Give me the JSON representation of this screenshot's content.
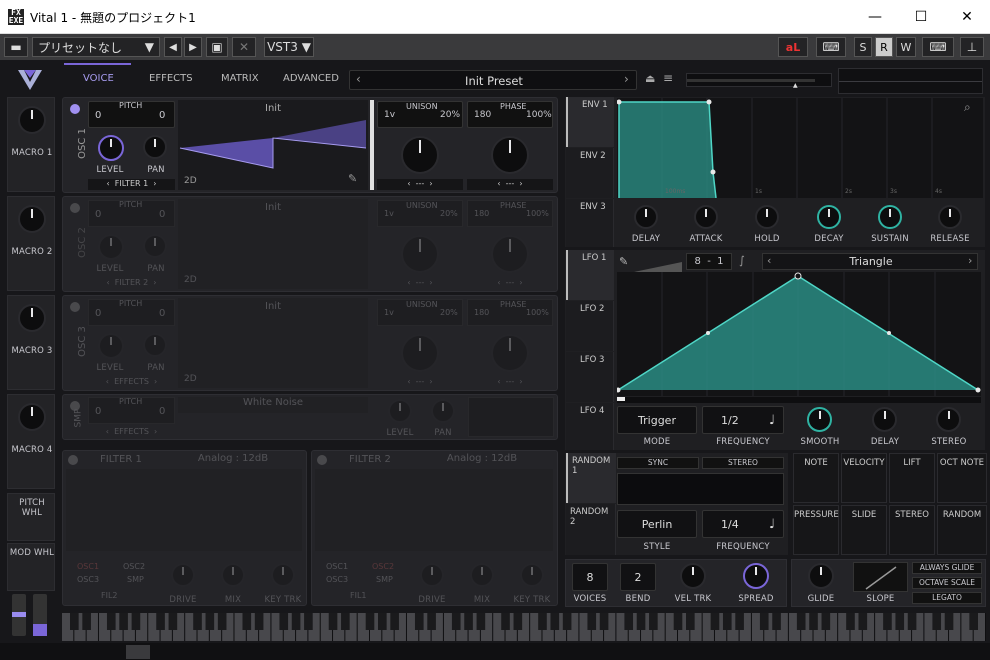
{
  "window": {
    "title": "Vital 1 - 無題のプロジェクト1",
    "app_icon": "FX\nEXE"
  },
  "host": {
    "preset": "プリセットなし",
    "format": "VST3",
    "s": "S",
    "r": "R",
    "w": "W",
    "bl": "aL"
  },
  "top": {
    "tabs": [
      "VOICE",
      "EFFECTS",
      "MATRIX",
      "ADVANCED"
    ],
    "preset_name": "Init Preset"
  },
  "macros": [
    "MACRO 1",
    "MACRO 2",
    "MACRO 3",
    "MACRO 4"
  ],
  "wheels": [
    "PITCH WHL",
    "MOD WHL"
  ],
  "osc1": {
    "label": "OSC 1",
    "pitch_label": "PITCH",
    "pitch_a": "0",
    "pitch_b": "0",
    "level": "LEVEL",
    "pan": "PAN",
    "filter": "FILTER 1",
    "wt_name": "Init",
    "mode": "2D",
    "unison": "UNISON",
    "uni_voices": "1v",
    "uni_detune": "20%",
    "phase": "PHASE",
    "phase_a": "180",
    "phase_b": "100%",
    "sel_a": "---",
    "sel_b": "---"
  },
  "osc2": {
    "label": "OSC 2",
    "pitch_label": "PITCH",
    "pitch_a": "0",
    "pitch_b": "0",
    "level": "LEVEL",
    "pan": "PAN",
    "filter": "FILTER 2",
    "wt_name": "Init",
    "mode": "2D",
    "unison": "UNISON",
    "uni_voices": "1v",
    "uni_detune": "20%",
    "phase": "PHASE",
    "phase_a": "180",
    "phase_b": "100%",
    "sel_a": "---",
    "sel_b": "---"
  },
  "osc3": {
    "label": "OSC 3",
    "pitch_label": "PITCH",
    "pitch_a": "0",
    "pitch_b": "0",
    "level": "LEVEL",
    "pan": "PAN",
    "filter": "EFFECTS",
    "wt_name": "Init",
    "mode": "2D",
    "unison": "UNISON",
    "uni_voices": "1v",
    "uni_detune": "20%",
    "phase": "PHASE",
    "phase_a": "180",
    "phase_b": "100%",
    "sel_a": "---",
    "sel_b": "---"
  },
  "smp": {
    "label": "SMP",
    "pitch_label": "PITCH",
    "pitch_a": "0",
    "pitch_b": "0",
    "effects": "EFFECTS",
    "name": "White Noise",
    "level": "LEVEL",
    "pan": "PAN"
  },
  "filter1": {
    "label": "FILTER 1",
    "type": "Analog : 12dB",
    "src": [
      "OSC1",
      "OSC2",
      "OSC3",
      "SMP"
    ],
    "route": "FIL2",
    "drive": "DRIVE",
    "mix": "MIX",
    "keytrk": "KEY TRK"
  },
  "filter2": {
    "label": "FILTER 2",
    "type": "Analog : 12dB",
    "src": [
      "OSC1",
      "OSC2",
      "OSC3",
      "SMP"
    ],
    "route": "FIL1",
    "drive": "DRIVE",
    "mix": "MIX",
    "keytrk": "KEY TRK"
  },
  "env": {
    "tabs": [
      "ENV 1",
      "ENV 2",
      "ENV 3"
    ],
    "knobs": [
      "DELAY",
      "ATTACK",
      "HOLD",
      "DECAY",
      "SUSTAIN",
      "RELEASE"
    ],
    "grid_labels": [
      "100ms",
      "1s",
      "2s",
      "3s",
      "4s"
    ]
  },
  "lfo": {
    "tabs": [
      "LFO 1",
      "LFO 2",
      "LFO 3",
      "LFO 4"
    ],
    "rate_a": "8",
    "rate_sep": "-",
    "rate_b": "1",
    "shape": "Triangle",
    "mode_value": "Trigger",
    "mode": "MODE",
    "freq_value": "1/2",
    "freq": "FREQUENCY",
    "knobs": [
      "SMOOTH",
      "DELAY",
      "STEREO"
    ]
  },
  "random": {
    "tabs": [
      "RANDOM 1",
      "RANDOM 2"
    ],
    "sync": "SYNC",
    "stereo": "STEREO",
    "style_value": "Perlin",
    "style": "STYLE",
    "freq_value": "1/4",
    "freq": "FREQUENCY"
  },
  "mods": [
    "NOTE",
    "VELOCITY",
    "LIFT",
    "OCT NOTE",
    "PRESSURE",
    "SLIDE",
    "STEREO",
    "RANDOM"
  ],
  "voice": {
    "voices_value": "8",
    "voices": "VOICES",
    "bend_value": "2",
    "bend": "BEND",
    "veltrk": "VEL TRK",
    "spread": "SPREAD",
    "glide": "GLIDE",
    "slope": "SLOPE",
    "always_glide": "ALWAYS GLIDE",
    "octave_scale": "OCTAVE SCALE",
    "legato": "LEGATO"
  },
  "colors": {
    "accent": "#a090f0",
    "teal": "#2fb3a3",
    "purple": "#7a66d8"
  }
}
